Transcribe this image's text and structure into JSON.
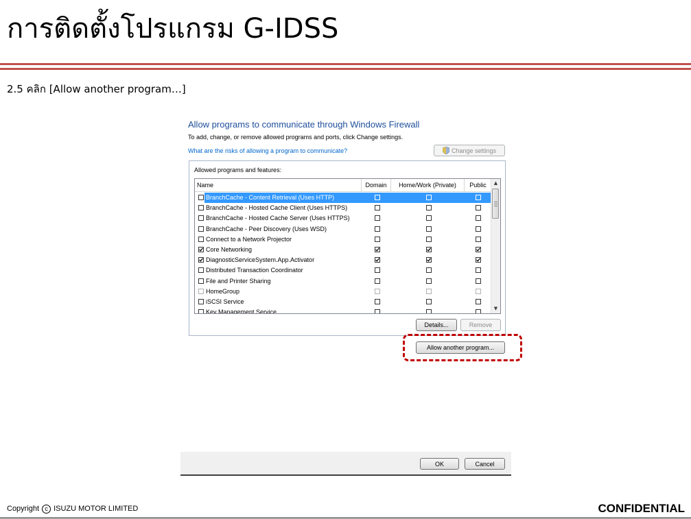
{
  "slide": {
    "title": "การติดตั้งโปรแกรม G-IDSS",
    "step": "2.5 คลิก [Allow another program…]",
    "rule_color": "#c0504d"
  },
  "dialog": {
    "heading": "Allow programs to communicate through Windows Firewall",
    "subtext": "To add, change, or remove allowed programs and ports, click Change settings.",
    "risk_link": "What are the risks of allowing a program to communicate?",
    "change_settings_label": "Change settings",
    "group_label": "Allowed programs and features:",
    "columns": [
      "Name",
      "Domain",
      "Home/Work (Private)",
      "Public"
    ],
    "rows": [
      {
        "name": "BranchCache - Content Retrieval (Uses HTTP)",
        "enabled": false,
        "domain": false,
        "home": false,
        "public": false,
        "selected": true,
        "disabled": false
      },
      {
        "name": "BranchCache - Hosted Cache Client (Uses HTTPS)",
        "enabled": false,
        "domain": false,
        "home": false,
        "public": false,
        "selected": false,
        "disabled": false
      },
      {
        "name": "BranchCache - Hosted Cache Server (Uses HTTPS)",
        "enabled": false,
        "domain": false,
        "home": false,
        "public": false,
        "selected": false,
        "disabled": false
      },
      {
        "name": "BranchCache - Peer Discovery (Uses WSD)",
        "enabled": false,
        "domain": false,
        "home": false,
        "public": false,
        "selected": false,
        "disabled": false
      },
      {
        "name": "Connect to a Network Projector",
        "enabled": false,
        "domain": false,
        "home": false,
        "public": false,
        "selected": false,
        "disabled": false
      },
      {
        "name": "Core Networking",
        "enabled": true,
        "domain": true,
        "home": true,
        "public": true,
        "selected": false,
        "disabled": false
      },
      {
        "name": "DiagnosticServiceSystem.App.Activator",
        "enabled": true,
        "domain": true,
        "home": true,
        "public": true,
        "selected": false,
        "disabled": false
      },
      {
        "name": "Distributed Transaction Coordinator",
        "enabled": false,
        "domain": false,
        "home": false,
        "public": false,
        "selected": false,
        "disabled": false
      },
      {
        "name": "File and Printer Sharing",
        "enabled": false,
        "domain": false,
        "home": false,
        "public": false,
        "selected": false,
        "disabled": false
      },
      {
        "name": "HomeGroup",
        "enabled": false,
        "domain": false,
        "home": false,
        "public": false,
        "selected": false,
        "disabled": true
      },
      {
        "name": "iSCSI Service",
        "enabled": false,
        "domain": false,
        "home": false,
        "public": false,
        "selected": false,
        "disabled": false
      },
      {
        "name": "Key Management Service",
        "enabled": false,
        "domain": false,
        "home": false,
        "public": false,
        "selected": false,
        "disabled": false
      }
    ],
    "details_label": "Details...",
    "remove_label": "Remove",
    "allow_another_label": "Allow another program...",
    "ok_label": "OK",
    "cancel_label": "Cancel",
    "heading_color": "#1e4e9a",
    "link_color": "#0066cc",
    "selection_color": "#3399ff",
    "highlight_color": "#c00000"
  },
  "footer": {
    "copyright_label": "Copyright",
    "copyright_symbol": "c",
    "company": "ISUZU MOTOR LIMITED",
    "confidential": "CONFIDENTIAL"
  },
  "icons": {
    "shield": "shield-icon",
    "checkmark": "checkmark-icon",
    "scroll_up": "scroll-up-arrow-icon",
    "scroll_down": "scroll-down-arrow-icon"
  }
}
